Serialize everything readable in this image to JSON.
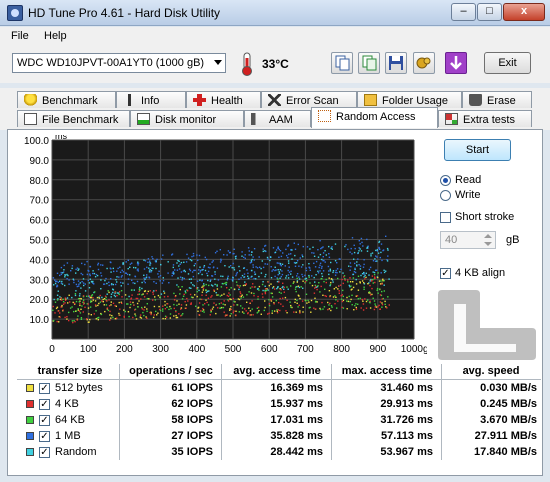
{
  "window": {
    "title": "HD Tune Pro 4.61 - Hard Disk Utility",
    "min": "–",
    "max": "□",
    "close": "x"
  },
  "menu": [
    "File",
    "Help"
  ],
  "toolbar": {
    "drive": "WDC WD10JPVT-00A1YT0 (1000 gB)",
    "temperature": "33°C",
    "exit": "Exit"
  },
  "tabs_row1": [
    "Benchmark",
    "Info",
    "Health",
    "Error Scan",
    "Folder Usage",
    "Erase"
  ],
  "tabs_row2": [
    "File Benchmark",
    "Disk monitor",
    "AAM",
    "Random Access",
    "Extra tests"
  ],
  "side": {
    "start": "Start",
    "read": "Read",
    "write": "Write",
    "short_stroke": "Short stroke",
    "stroke_value": "40",
    "stroke_unit": "gB",
    "align": "4 KB align"
  },
  "chart_data": {
    "type": "scatter",
    "ylabel": "ms",
    "xunit": "gB",
    "ylim": [
      0,
      100
    ],
    "xlim": [
      0,
      1000
    ],
    "yticks": [
      "100.0",
      "90.0",
      "80.0",
      "70.0",
      "60.0",
      "50.0",
      "40.0",
      "30.0",
      "20.0",
      "10.0"
    ],
    "xticks": [
      "0",
      "100",
      "200",
      "300",
      "400",
      "500",
      "600",
      "700",
      "800",
      "900",
      "1000gB"
    ],
    "grid": true,
    "series": [
      {
        "name": "512 bytes",
        "color": "#f0e040",
        "band": [
          [
            0,
            8,
            22
          ],
          [
            1000,
            16,
            34
          ]
        ]
      },
      {
        "name": "4 KB",
        "color": "#e03030",
        "band": [
          [
            0,
            8,
            22
          ],
          [
            1000,
            16,
            34
          ]
        ]
      },
      {
        "name": "64 KB",
        "color": "#40d040",
        "band": [
          [
            0,
            9,
            23
          ],
          [
            1000,
            17,
            35
          ]
        ]
      },
      {
        "name": "1 MB",
        "color": "#3070e0",
        "band": [
          [
            0,
            26,
            38
          ],
          [
            1000,
            34,
            54
          ]
        ]
      },
      {
        "name": "Random",
        "color": "#40d0e0",
        "band": [
          [
            0,
            20,
            36
          ],
          [
            1000,
            28,
            52
          ]
        ]
      }
    ]
  },
  "table": {
    "headers": [
      "transfer size",
      "operations / sec",
      "avg. access time",
      "max. access time",
      "avg. speed"
    ],
    "rows": [
      {
        "name": "512 bytes",
        "color": "#f0e040",
        "ops": "61 IOPS",
        "avg": "16.369 ms",
        "max": "31.460 ms",
        "speed": "0.030 MB/s"
      },
      {
        "name": "4 KB",
        "color": "#e03030",
        "ops": "62 IOPS",
        "avg": "15.937 ms",
        "max": "29.913 ms",
        "speed": "0.245 MB/s"
      },
      {
        "name": "64 KB",
        "color": "#40d040",
        "ops": "58 IOPS",
        "avg": "17.031 ms",
        "max": "31.726 ms",
        "speed": "3.670 MB/s"
      },
      {
        "name": "1 MB",
        "color": "#3070e0",
        "ops": "27 IOPS",
        "avg": "35.828 ms",
        "max": "57.113 ms",
        "speed": "27.911 MB/s"
      },
      {
        "name": "Random",
        "color": "#40d0e0",
        "ops": "35 IOPS",
        "avg": "28.442 ms",
        "max": "53.967 ms",
        "speed": "17.840 MB/s"
      }
    ]
  }
}
